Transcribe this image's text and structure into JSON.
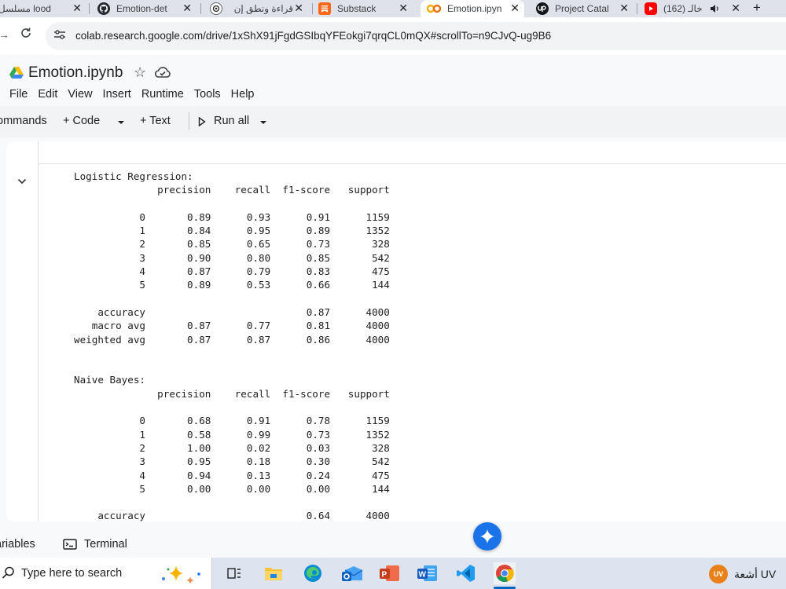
{
  "browser": {
    "tabs": [
      {
        "label": "مسلسل lood",
        "favicon": "text-tab-favicon"
      },
      {
        "label": "Emotion-det",
        "favicon": "github-icon"
      },
      {
        "label": "قراءة ونطق إن",
        "favicon": "chatgpt-icon"
      },
      {
        "label": "Substack",
        "favicon": "substack-icon"
      },
      {
        "label": "Emotion.ipyn",
        "favicon": "colab-icon",
        "active": true
      },
      {
        "label": "Project Catal",
        "favicon": "upwork-icon"
      },
      {
        "label": "(162) خالـ",
        "favicon": "youtube-icon"
      }
    ],
    "close_glyph": "✕",
    "new_tab_glyph": "+",
    "url": "colab.research.google.com/drive/1xShX91jFgdGSIbqYFEokgi7qrqCL0mQX#scrollTo=n9CJvQ-ug9B6"
  },
  "colab": {
    "title": "Emotion.ipynb",
    "menu": [
      "File",
      "Edit",
      "View",
      "Insert",
      "Runtime",
      "Tools",
      "Help"
    ],
    "toolbar": {
      "commands": "ommands",
      "code": "+ Code",
      "text": "+ Text",
      "run_all": "Run all"
    },
    "output_text": "Logistic Regression:\n              precision    recall  f1-score   support\n\n           0       0.89      0.93      0.91      1159\n           1       0.84      0.95      0.89      1352\n           2       0.85      0.65      0.73       328\n           3       0.90      0.80      0.85       542\n           4       0.87      0.79      0.83       475\n           5       0.89      0.53      0.66       144\n\n    accuracy                           0.87      4000\n   macro avg       0.87      0.77      0.81      4000\nweighted avg       0.87      0.87      0.86      4000\n\n\nNaive Bayes:\n              precision    recall  f1-score   support\n\n           0       0.68      0.91      0.78      1159\n           1       0.58      0.99      0.73      1352\n           2       1.00      0.02      0.03       328\n           3       0.95      0.18      0.30       542\n           4       0.94      0.13      0.24       475\n           5       0.00      0.00      0.00       144\n\n    accuracy                           0.64      4000",
    "bottom": {
      "variables": "ariables",
      "terminal": "Terminal"
    }
  },
  "taskbar": {
    "search_placeholder": "Type here to search",
    "apps": [
      "task-view-icon",
      "file-explorer-icon",
      "edge-icon",
      "outlook-icon",
      "powerpoint-icon",
      "word-icon",
      "vscode-icon",
      "chrome-icon"
    ],
    "weather_badge": "UV",
    "weather_text": "أشعة UV"
  },
  "colors": {
    "accent_blue": "#1a73e8",
    "chrome_tab_bg": "#dfe3e9",
    "colab_orange": "#f9ab00",
    "youtube_red": "#ff0000",
    "substack_orange": "#ff6719"
  }
}
